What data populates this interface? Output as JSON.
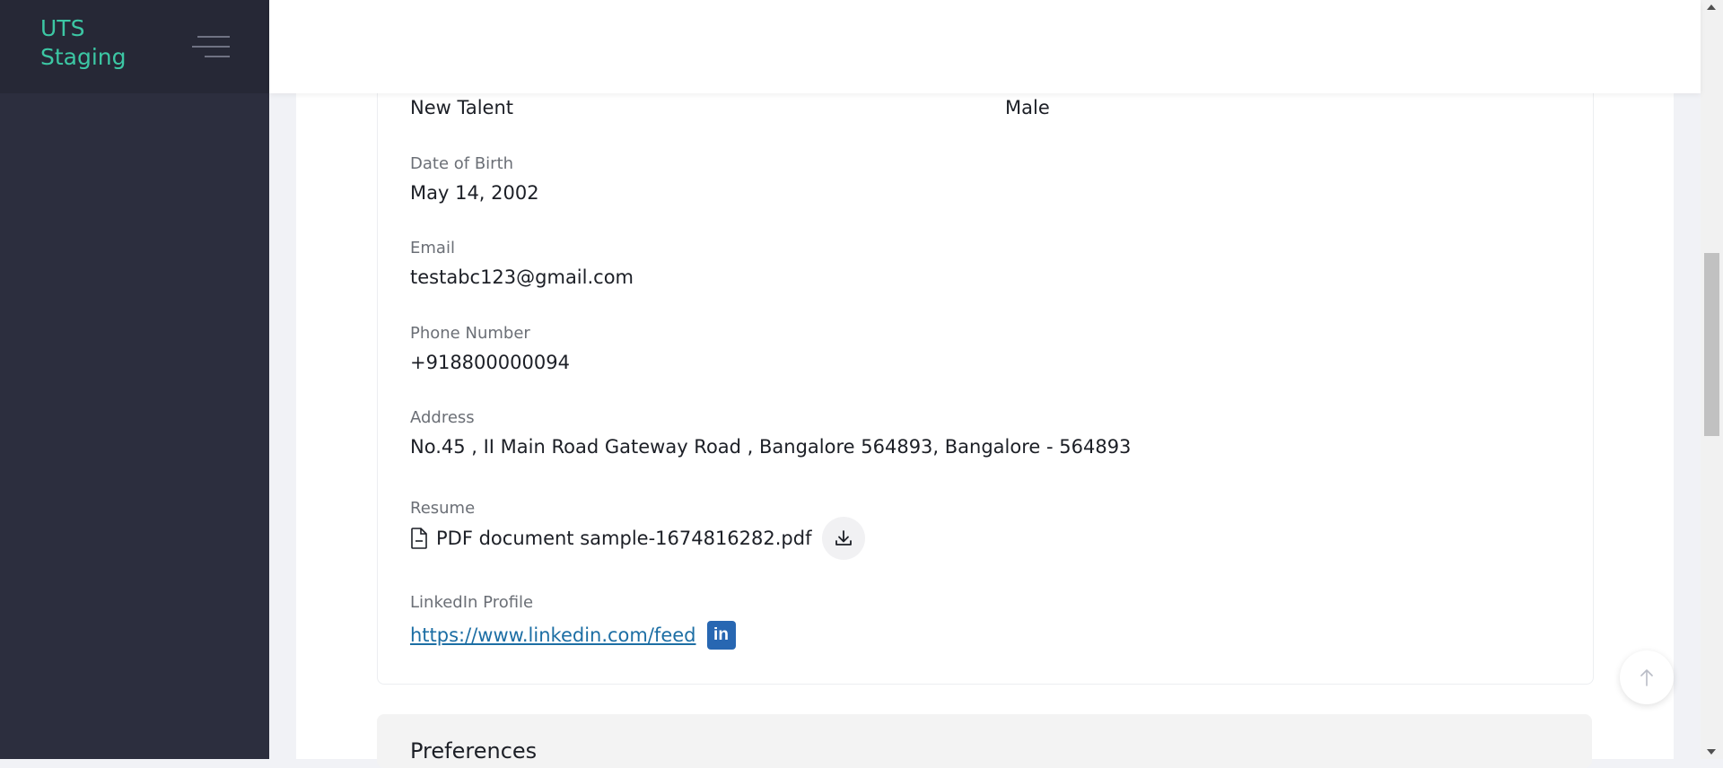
{
  "sidebar": {
    "logo_line1": "UTS",
    "logo_line2": "Staging",
    "menu_icon": "hamburger-icon"
  },
  "profile": {
    "talent_type_value": "New Talent",
    "gender_value": "Male",
    "dob_label": "Date of Birth",
    "dob_value": "May 14, 2002",
    "email_label": "Email",
    "email_value": "testabc123@gmail.com",
    "phone_label": "Phone Number",
    "phone_value": "+918800000094",
    "address_label": "Address",
    "address_value": "No.45 , II Main Road Gateway Road , Bangalore 564893, Bangalore - 564893",
    "resume_label": "Resume",
    "resume_file": "PDF document sample-1674816282.pdf",
    "linkedin_label": "LinkedIn Profile",
    "linkedin_url": "https://www.linkedin.com/feed",
    "linkedin_badge": "in"
  },
  "preferences": {
    "title": "Preferences"
  },
  "colors": {
    "sidebar_bg": "#2c2e3e",
    "logo": "#3cc7a4",
    "link": "#1c6ea4",
    "linkedin": "#2867b2"
  }
}
